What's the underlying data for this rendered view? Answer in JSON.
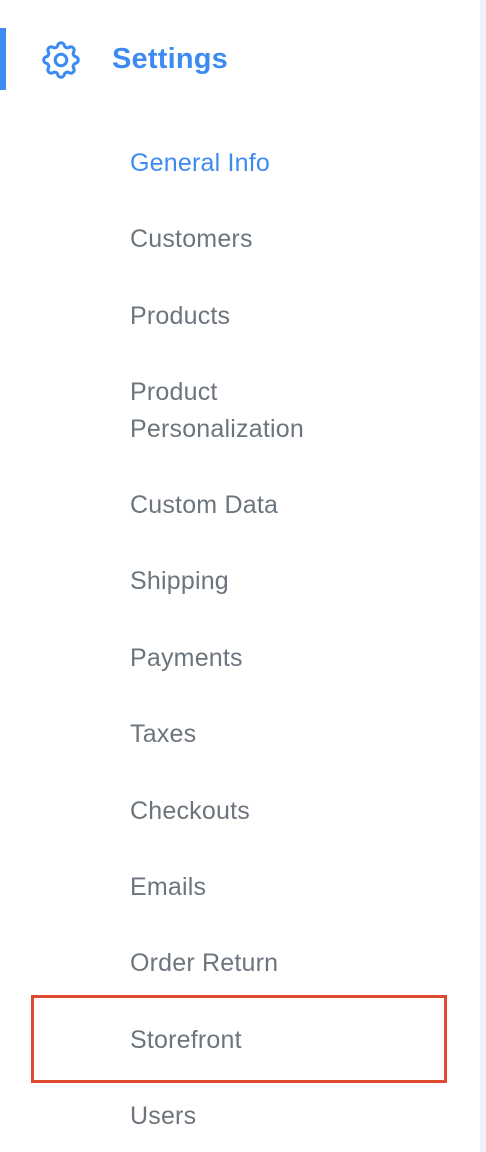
{
  "header": {
    "icon": "gear-icon",
    "title": "Settings",
    "accent_color": "#3d8bf2"
  },
  "nav": {
    "text_color": "#6c757d",
    "active_color": "#3d8bf2",
    "highlight_color": "#e04a2f",
    "items": [
      {
        "label": "General Info",
        "active": true
      },
      {
        "label": "Customers"
      },
      {
        "label": "Products"
      },
      {
        "label": "Product",
        "label_line2": "Personalization"
      },
      {
        "label": "Custom Data"
      },
      {
        "label": "Shipping"
      },
      {
        "label": "Payments"
      },
      {
        "label": "Taxes"
      },
      {
        "label": "Checkouts"
      },
      {
        "label": "Emails"
      },
      {
        "label": "Order Return"
      },
      {
        "label": "Storefront",
        "highlighted": true
      },
      {
        "label": "Users"
      }
    ]
  }
}
